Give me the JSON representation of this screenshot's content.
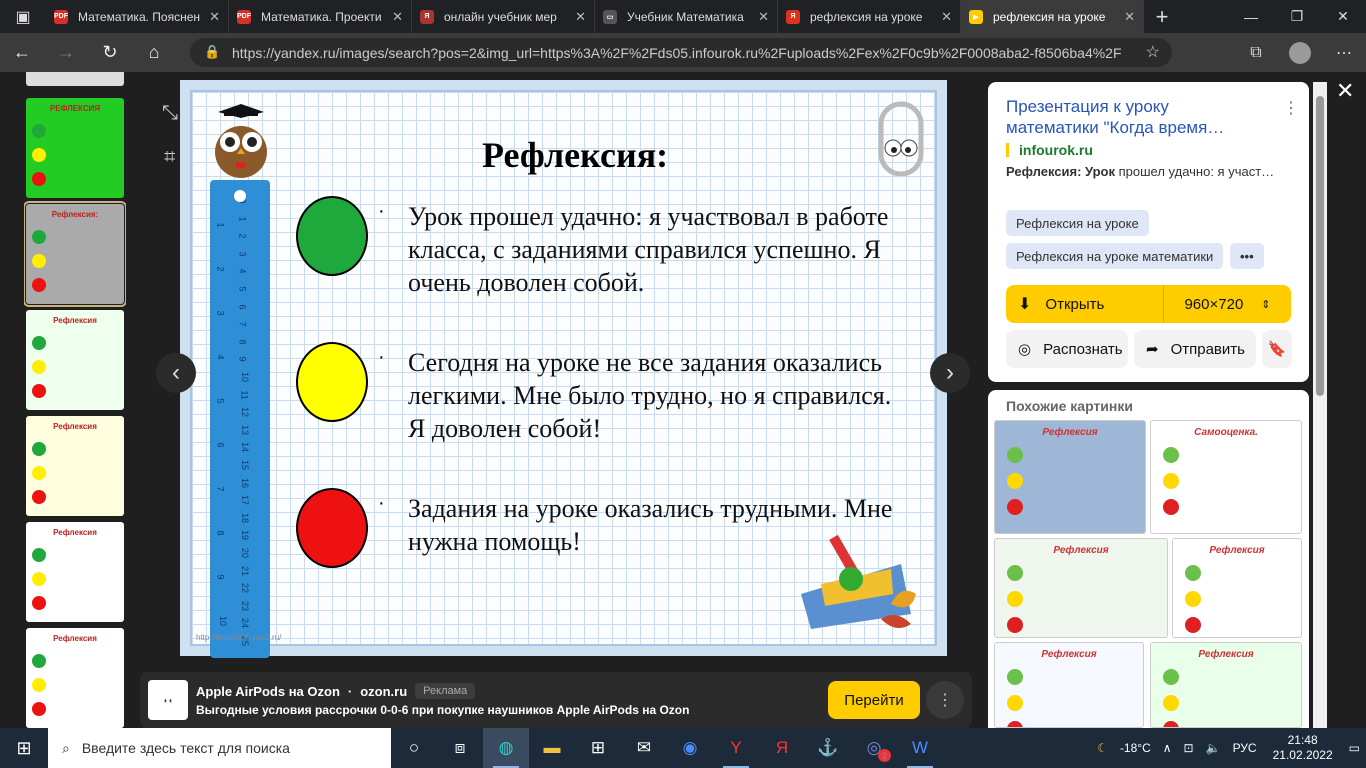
{
  "tabs": [
    {
      "label": "Математика. Пояснен",
      "fav": "PDF",
      "color": "#d93025"
    },
    {
      "label": "Математика. Проекти",
      "fav": "PDF",
      "color": "#d93025"
    },
    {
      "label": "онлайн учебник мер",
      "fav": "Я",
      "color": "#a33"
    },
    {
      "label": "Учебник Математика",
      "fav": "▭",
      "color": "#555"
    },
    {
      "label": "рефлексия на уроке",
      "fav": "Я",
      "color": "#e0301e"
    },
    {
      "label": "рефлексия на уроке",
      "fav": "▶",
      "color": "#ffcc00"
    }
  ],
  "address": {
    "url": "https://yandex.ru/images/search?pos=2&img_url=https%3A%2F%2Fds05.infourok.ru%2Fuploads%2Fex%2F0c9b%2F0008aba2-f8506ba4%2F2%"
  },
  "slide": {
    "title": "Рефлексия:",
    "rows": [
      {
        "text": "Урок прошел удачно: я участвовал в работе класса, с заданиями справился успешно. Я очень доволен собой.",
        "color": "#1fa83c"
      },
      {
        "text": "Сегодня на уроке не все задания оказались легкими. Мне было трудно, но я справился. Я доволен собой!",
        "color": "#ffff00"
      },
      {
        "text": "Задания на уроке оказались трудными. Мне нужна помощь!",
        "color": "#ee1111"
      }
    ],
    "bullet": "·",
    "ruler_marks": [
      "0",
      "1",
      "2",
      "3",
      "4",
      "5",
      "6",
      "7",
      "8",
      "9",
      "10",
      "11",
      "12",
      "13",
      "14",
      "15",
      "16",
      "17",
      "18",
      "19",
      "20",
      "21",
      "22",
      "23",
      "24",
      "25"
    ],
    "ruler_left_marks": [
      "1",
      "2",
      "3",
      "4",
      "5",
      "6",
      "7",
      "8",
      "9",
      "10"
    ],
    "footnote": "http://linda6035.ucoz.ru/"
  },
  "panel": {
    "title": "Презентация к уроку математики \"Когда время…",
    "source": "infourok.ru",
    "desc_bold": "Рефлексия: Урок",
    "desc_rest": " прошел удачно: я участ…",
    "chips": [
      "Рефлексия на уроке",
      "Рефлексия на уроке математики",
      "•••"
    ],
    "open_label": "Открыть",
    "size_label": "960×720",
    "recognize_label": "Распознать",
    "send_label": "Отправить",
    "similar_label": "Похожие картинки"
  },
  "similar_titles": [
    "Рефлексия",
    "Самооценка.",
    "Рефлексия",
    "Рефлексия",
    "Рефлексия",
    "Рефлексия"
  ],
  "thumb_titles": [
    "РЕФЛЕКСИЯ",
    "Рефлексия:",
    "Рефлексия",
    "Рефлексия",
    "Рефлексия",
    "Рефлексия"
  ],
  "ad": {
    "title": "Apple AirPods на Ozon",
    "domain": "ozon.ru",
    "badge": "Реклама",
    "text": "Выгодные условия рассрочки 0-0-6 при покупке наушников Apple AirPods на Ozon",
    "button": "Перейти"
  },
  "taskbar": {
    "search_placeholder": "Введите здесь текст для поиска",
    "temp": "-18°C",
    "lang": "РУС",
    "time": "21:48",
    "date": "21.02.2022",
    "notif_count": "2"
  }
}
